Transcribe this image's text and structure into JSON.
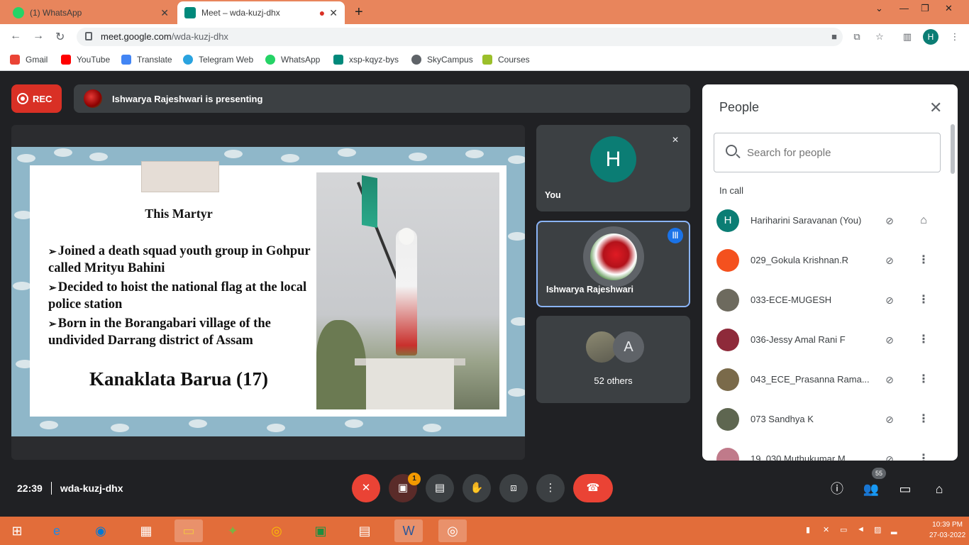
{
  "browser": {
    "tabs": [
      {
        "title": "(1) WhatsApp",
        "active": false
      },
      {
        "title": "Meet – wda-kuzj-dhx",
        "active": true
      }
    ],
    "new_tab": "+",
    "url_host": "meet.google.com",
    "url_path": "/wda-kuzj-dhx",
    "profile_initial": "H",
    "bookmarks": [
      "Gmail",
      "YouTube",
      "Translate",
      "Telegram Web",
      "WhatsApp",
      "xsp-kqyz-bys",
      "SkyCampus",
      "Courses"
    ]
  },
  "meet": {
    "rec_label": "REC",
    "presenting_text": "Ishwarya Rajeshwari is presenting",
    "slide": {
      "title": "This Martyr",
      "bullets": [
        "Joined a death squad youth group in Gohpur called Mrityu Bahini",
        "Decided to hoist the national flag at the local police station",
        "Born in the Borangabari village of the undivided Darrang district of Assam"
      ],
      "name": "Kanaklata Barua (17)"
    },
    "tiles": {
      "you_initial": "H",
      "you_label": "You",
      "presenter_label": "Ishwarya Rajeshwari",
      "others_initial": "A",
      "others_label": "52 others"
    },
    "people_panel": {
      "title": "People",
      "search_placeholder": "Search for people",
      "section_label": "In call",
      "participants": [
        {
          "name": "Hariharini Saravanan (You)",
          "avatar": "H",
          "color": "#0b7d74"
        },
        {
          "name": "029_Gokula Krishnan.R",
          "avatar": "",
          "color": "#f4511e"
        },
        {
          "name": "033-ECE-MUGESH",
          "avatar": "",
          "color": "#6d6a5e"
        },
        {
          "name": "036-Jessy Amal Rani F",
          "avatar": "",
          "color": "#8e2a3a"
        },
        {
          "name": "043_ECE_Prasanna Rama...",
          "avatar": "",
          "color": "#7a6a4a"
        },
        {
          "name": "073 Sandhya K",
          "avatar": "",
          "color": "#5e6650"
        },
        {
          "name": "19_030 Muthukumar M",
          "avatar": "",
          "color": "#c07a8a"
        }
      ]
    },
    "footer": {
      "time": "22:39",
      "meeting_code": "wda-kuzj-dhx",
      "chat_badge": "1",
      "people_count": "55"
    }
  },
  "taskbar": {
    "clock_time": "10:39 PM",
    "clock_date": "27-03-2022"
  },
  "colors": {
    "chrome_tab_bar": "#e8855c",
    "meet_bg": "#202124",
    "accent_red": "#ea4335",
    "teal_avatar": "#0b7d74",
    "speaking_blue": "#1a73e8",
    "taskbar": "#e26d3a"
  }
}
